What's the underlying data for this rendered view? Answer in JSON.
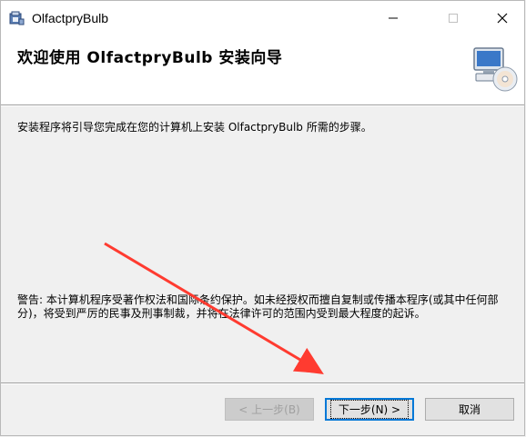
{
  "window": {
    "title": "OlfactpryBulb"
  },
  "titlebar": {
    "minimize_icon": "minimize-icon",
    "maximize_icon": "maximize-icon",
    "close_icon": "close-icon"
  },
  "header": {
    "title": "欢迎使用 OlfactpryBulb 安装向导",
    "art_icon": "computer-cd-icon"
  },
  "body": {
    "intro": "安装程序将引导您完成在您的计算机上安装 OlfactpryBulb 所需的步骤。",
    "warning": "警告: 本计算机程序受著作权法和国际条约保护。如未经授权而擅自复制或传播本程序(或其中任何部分)，将受到严厉的民事及刑事制裁，并将在法律许可的范围内受到最大程度的起诉。"
  },
  "buttons": {
    "back": "< 上一步(B)",
    "next": "下一步(N) >",
    "cancel": "取消"
  },
  "colors": {
    "accent": "#0078d7",
    "arrow": "#ff3b30"
  }
}
